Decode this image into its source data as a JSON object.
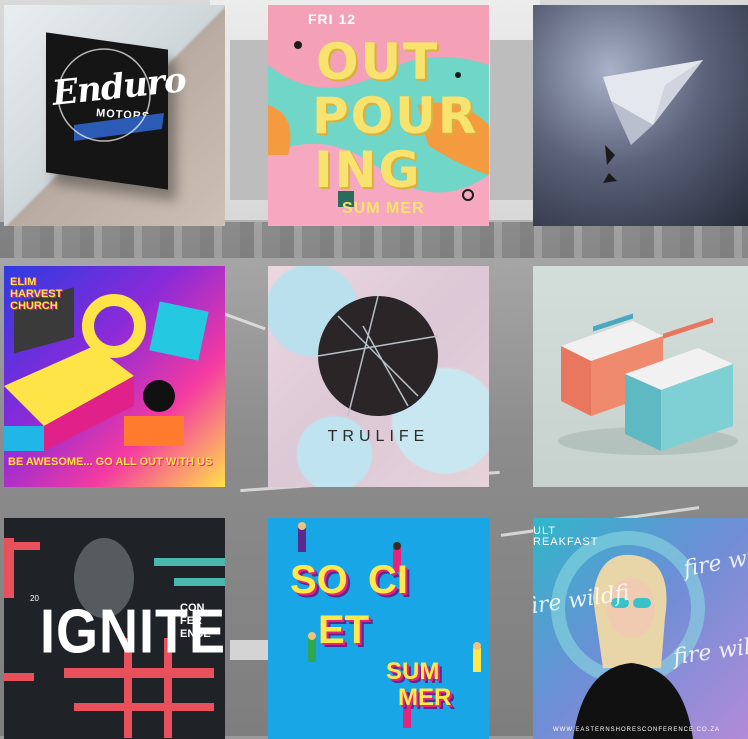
{
  "gallery": {
    "tiles": [
      {
        "id": "enduro",
        "brand": "Enduro",
        "sub": "MOTORS"
      },
      {
        "id": "outpouring",
        "lines": [
          "OUT",
          "POUR",
          "ING"
        ],
        "small": "SUM MER",
        "date": "FRI 12"
      },
      {
        "id": "paper-plane"
      },
      {
        "id": "go-all-out",
        "header": "ELIM\nHARVEST\nCHURCH",
        "footer": "BE AWESOME... GO ALL OUT WITH US"
      },
      {
        "id": "trulife",
        "word": "TRULIFE"
      },
      {
        "id": "business-cards"
      },
      {
        "id": "ignite",
        "title": "IGNITE",
        "conf": "CON\nFER\nENCE",
        "year": "20"
      },
      {
        "id": "society-summer",
        "words": [
          "SO",
          "CI",
          "ET",
          "SUM",
          "MER"
        ]
      },
      {
        "id": "wildfire",
        "top": "ULT\nREAKFAST",
        "script": "fire wildfi",
        "url": "WWW.EASTERNSHORESCONFERENCE.CO.ZA"
      }
    ]
  },
  "colors": {
    "bg": "#9a9a9a",
    "outpouring_bg": "#6fd6c8",
    "outpouring_text": "#f7e36d",
    "society_bg": "#18a6e6",
    "ignite_bg": "#1f2327",
    "ignite_accent": "#e8505b",
    "wildfire_bg": "#2fb7c9"
  }
}
